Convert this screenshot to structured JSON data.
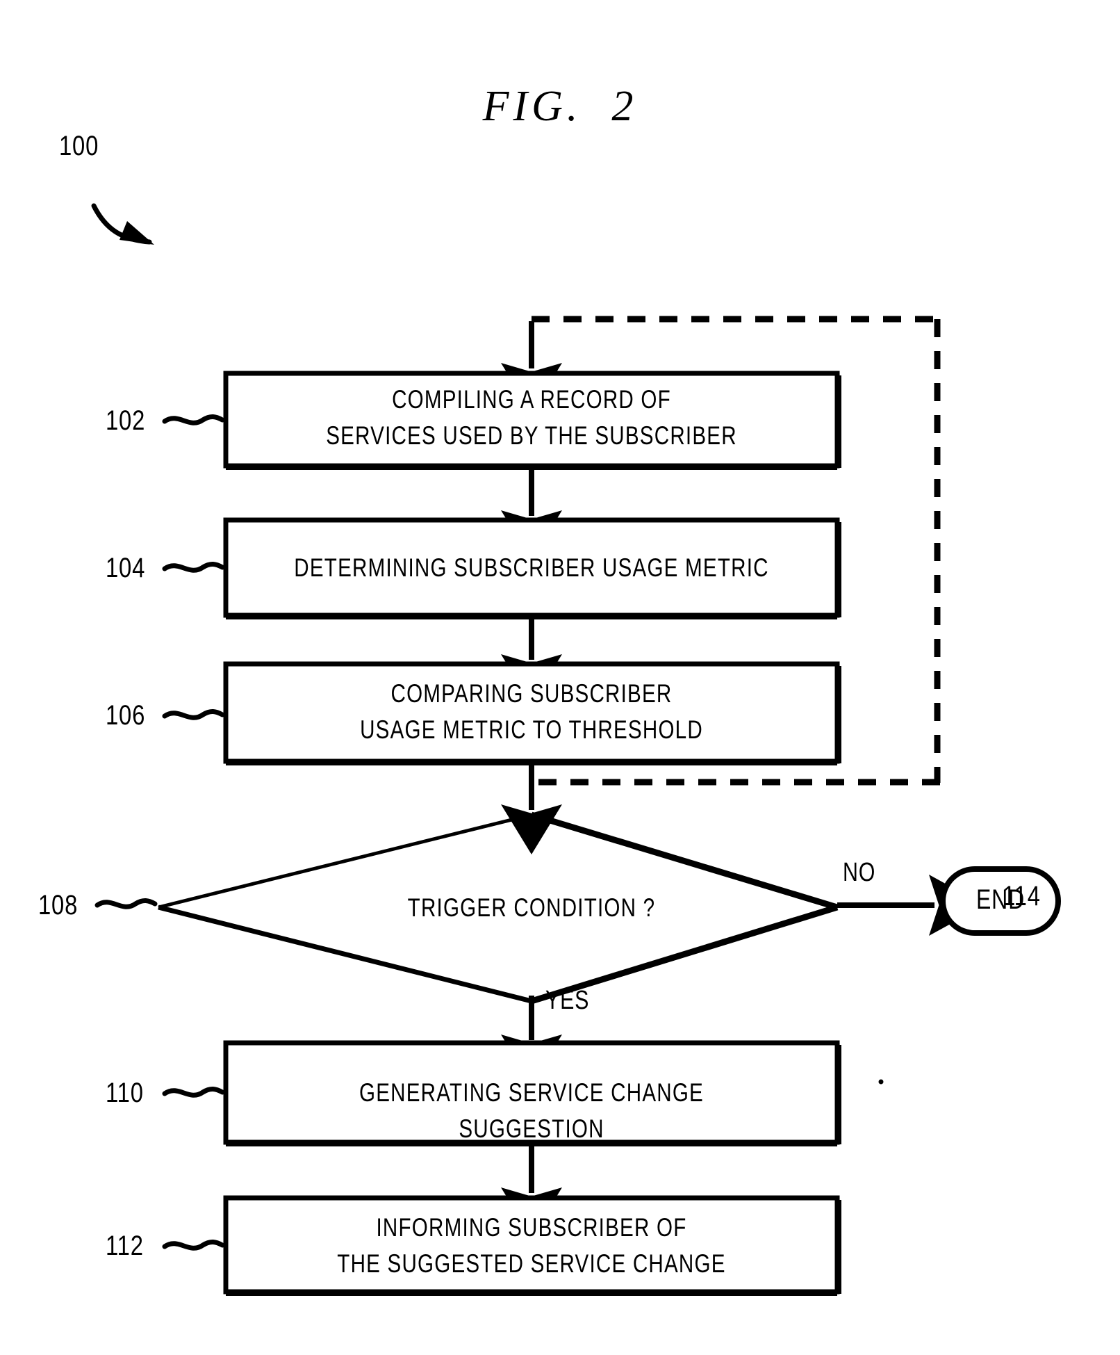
{
  "figure": {
    "title": "FIG.  2",
    "overall_ref": "100",
    "feedback_ref": "114"
  },
  "nodes": [
    {
      "ref": "102",
      "type": "process",
      "text": "COMPILING A RECORD OF\nSERVICES USED BY THE SUBSCRIBER"
    },
    {
      "ref": "104",
      "type": "process",
      "text": "DETERMINING SUBSCRIBER USAGE METRIC"
    },
    {
      "ref": "106",
      "type": "process",
      "text": "COMPARING SUBSCRIBER\nUSAGE METRIC TO THRESHOLD"
    },
    {
      "ref": "108",
      "type": "decision",
      "text": "TRIGGER CONDITION ?"
    },
    {
      "ref": "110",
      "type": "process",
      "text": "GENERATING SERVICE CHANGE SUGGESTION"
    },
    {
      "ref": "112",
      "type": "process",
      "text": "INFORMING SUBSCRIBER OF\nTHE SUGGESTED SERVICE CHANGE"
    }
  ],
  "terminator": {
    "label": "END"
  },
  "branch_labels": {
    "no": "NO",
    "yes": "YES"
  },
  "colors": {
    "stroke": "#000000",
    "fill": "#ffffff"
  }
}
